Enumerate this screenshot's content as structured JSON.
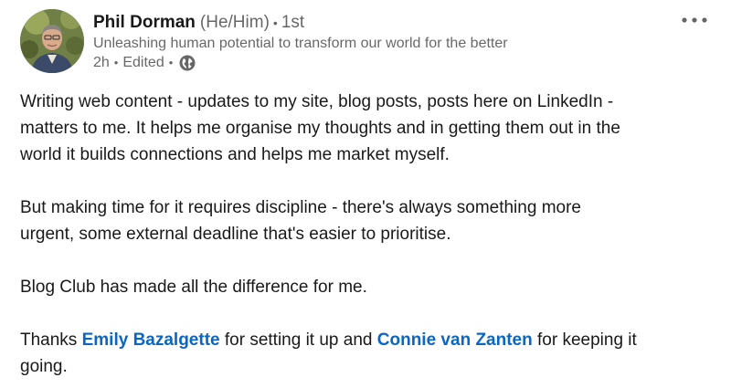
{
  "author": {
    "name": "Phil Dorman",
    "pronouns": "(He/Him)",
    "degree": "1st",
    "headline": "Unleashing human potential to transform our world for the better"
  },
  "meta": {
    "time": "2h",
    "edited": "Edited",
    "visibility_icon": "globe-icon"
  },
  "more_icon": "ellipsis-icon",
  "post": {
    "p1_line1": "Writing web content - updates to my site, blog posts, posts here on LinkedIn -",
    "p1_line2": "matters to me. It helps me organise my thoughts and in getting them out in the",
    "p1_line3": "world it builds connections and helps me market myself.",
    "p2_line1": "But making time for it requires discipline - there's always something more",
    "p2_line2": "urgent, some external deadline that's easier to prioritise.",
    "p3": "Blog Club has made all the difference for me.",
    "p4_prefix": "Thanks ",
    "mention1": "Emily Bazalgette",
    "p4_middle": " for setting it up and ",
    "mention2": "Connie van Zanten",
    "p4_suffix_line1": " for keeping it",
    "p4_line2": "going."
  },
  "colors": {
    "link": "#0a66c2",
    "text": "#191919",
    "muted": "#666666"
  }
}
